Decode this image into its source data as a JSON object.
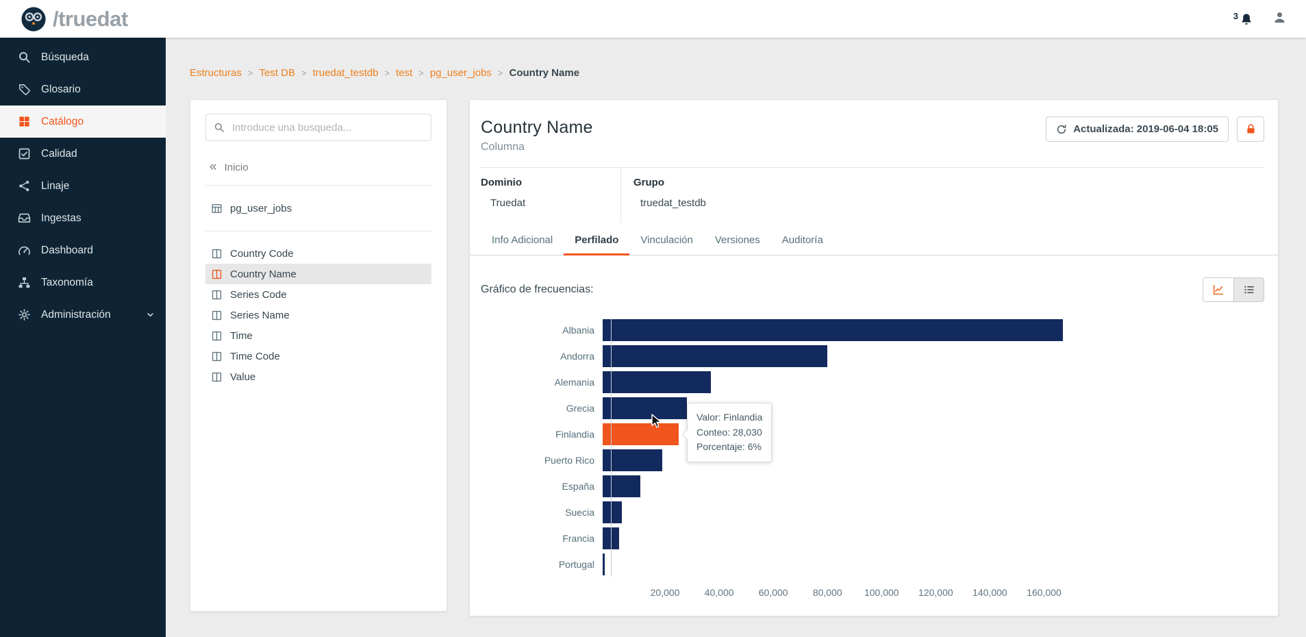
{
  "header": {
    "brand": "/truedat",
    "notification_count": "3"
  },
  "sidebar": {
    "items": [
      {
        "label": "Búsqueda",
        "icon": "search",
        "active": false
      },
      {
        "label": "Glosario",
        "icon": "tag",
        "active": false
      },
      {
        "label": "Catálogo",
        "icon": "grid",
        "active": true
      },
      {
        "label": "Calidad",
        "icon": "check",
        "active": false
      },
      {
        "label": "Linaje",
        "icon": "share",
        "active": false
      },
      {
        "label": "Ingestas",
        "icon": "inbox",
        "active": false
      },
      {
        "label": "Dashboard",
        "icon": "dashboard",
        "active": false
      },
      {
        "label": "Taxonomía",
        "icon": "sitemap",
        "active": false
      },
      {
        "label": "Administración",
        "icon": "gear",
        "active": false,
        "has_chevron": true
      }
    ]
  },
  "breadcrumb": {
    "separator": ">",
    "items": [
      "Estructuras",
      "Test DB",
      "truedat_testdb",
      "test",
      "pg_user_jobs",
      "Country Name"
    ]
  },
  "panel": {
    "search_placeholder": "Introduce una busqueda...",
    "back_label": "Inicio",
    "table_item": "pg_user_jobs",
    "columns": [
      "Country Code",
      "Country Name",
      "Series Code",
      "Series Name",
      "Time",
      "Time Code",
      "Value"
    ],
    "selected_column": "Country Name"
  },
  "detail": {
    "title": "Country Name",
    "subtitle": "Columna",
    "updated_label": "Actualizada: 2019-06-04 18:05",
    "fields": [
      {
        "label": "Dominio",
        "value": "Truedat"
      },
      {
        "label": "Grupo",
        "value": "truedat_testdb"
      }
    ],
    "tabs": [
      "Info Adicional",
      "Perfilado",
      "Vinculación",
      "Versiones",
      "Auditoría"
    ],
    "active_tab": "Perfilado",
    "chart_label": "Gráfico de frecuencias:"
  },
  "colors": {
    "accent": "#f0551e",
    "breadcrumb_link": "#ee7f1d",
    "sidebar_bg": "#0e2434",
    "bar_navy": "#132a5e"
  },
  "chart_data": {
    "type": "bar",
    "orientation": "horizontal",
    "categories": [
      "Albania",
      "Andorra",
      "Alemania",
      "Grecia",
      "Finlandia",
      "Puerto Rico",
      "España",
      "Suecia",
      "Francia",
      "Portugal"
    ],
    "values": [
      170000,
      83000,
      40000,
      31000,
      28030,
      22000,
      14000,
      7000,
      6000,
      700
    ],
    "highlighted_category": "Finlandia",
    "highlighted_value": 28030,
    "highlighted_pct": "6%",
    "bar_color": "#132a5e",
    "highlight_color": "#f0551e",
    "xlim": [
      0,
      170000
    ],
    "x_tick_values": [
      20000,
      40000,
      60000,
      80000,
      100000,
      120000,
      140000,
      160000
    ],
    "x_ticks": [
      "20,000",
      "40,000",
      "60,000",
      "80,000",
      "100,000",
      "120,000",
      "140,000",
      "160,000"
    ],
    "grid": false,
    "legend": false,
    "tooltip": {
      "lines": [
        "Valor: Finlandia",
        "Conteo: 28,030",
        "Porcentaje: 6%"
      ]
    }
  }
}
